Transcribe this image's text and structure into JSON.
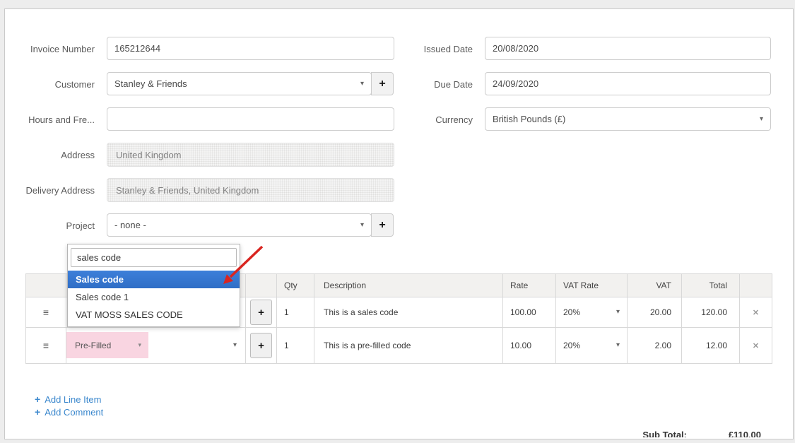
{
  "icons": {
    "caret": "▾",
    "plus": "+",
    "delete": "✕",
    "drag": "≡"
  },
  "colors": {
    "page_background": "#ededed",
    "dropdown_highlight": "#3875d7",
    "link_blue": "#3a87cd",
    "prefilled_pink": "#f9d5e1",
    "arrow_red": "#d92520"
  },
  "form": {
    "invoice_number": {
      "label": "Invoice Number",
      "value": "165212644"
    },
    "customer": {
      "label": "Customer",
      "value": "Stanley & Friends"
    },
    "hours_and_frequency": {
      "label": "Hours and Fre...",
      "value": ""
    },
    "address": {
      "label": "Address",
      "value": "United Kingdom"
    },
    "delivery_address": {
      "label": "Delivery Address",
      "value": "Stanley & Friends, United Kingdom"
    },
    "project": {
      "label": "Project",
      "value": "- none -"
    },
    "issued_date": {
      "label": "Issued Date",
      "value": "20/08/2020"
    },
    "due_date": {
      "label": "Due Date",
      "value": "24/09/2020"
    },
    "currency": {
      "label": "Currency",
      "value": "British Pounds (£)"
    }
  },
  "sales_code_dropdown": {
    "search_value": "sales code",
    "options": [
      "Sales code",
      "Sales code 1",
      "VAT MOSS SALES CODE"
    ],
    "highlighted_option": "Sales code"
  },
  "line_items": {
    "headers": {
      "qty": "Qty",
      "description": "Description",
      "rate": "Rate",
      "vat_rate": "VAT Rate",
      "vat": "VAT",
      "total": "Total"
    },
    "rows": [
      {
        "qty": "1",
        "description": "This is a sales code",
        "rate": "100.00",
        "vat_rate": "20%",
        "vat": "20.00",
        "total": "120.00"
      },
      {
        "code_select": "Pre-Filled",
        "qty": "1",
        "description": "This is a pre-filled code",
        "rate": "10.00",
        "vat_rate": "20%",
        "vat": "2.00",
        "total": "12.00"
      }
    ]
  },
  "actions": {
    "add_line_item": "Add Line Item",
    "add_comment": "Add Comment"
  },
  "totals": {
    "sub_total_label": "Sub Total:",
    "sub_total_value": "£110.00"
  }
}
